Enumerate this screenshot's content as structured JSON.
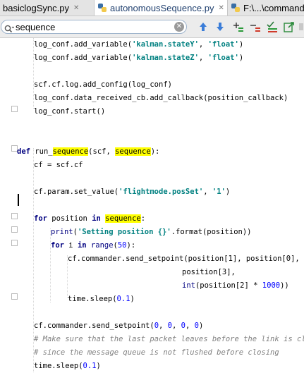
{
  "tabs": [
    {
      "label": "basiclogSync.py",
      "active": false
    },
    {
      "label": "autonomousSequence.py",
      "active": true
    },
    {
      "label": "F:\\...\\command",
      "active": false
    }
  ],
  "search": {
    "value": "sequence",
    "clear_icon": "✕"
  },
  "toolbar_icons": [
    "arrow-up-icon",
    "arrow-down-icon",
    "add-selection-icon",
    "remove-selection-icon",
    "select-all-icon",
    "export-icon",
    "more-icon"
  ],
  "code": [
    {
      "indent": 1,
      "segs": [
        [
          "p",
          "log_conf.add_variable("
        ],
        [
          "s",
          "'kalman.stateY'"
        ],
        [
          "p",
          ", "
        ],
        [
          "s",
          "'float'"
        ],
        [
          "p",
          ")"
        ]
      ]
    },
    {
      "indent": 1,
      "segs": [
        [
          "p",
          "log_conf.add_variable("
        ],
        [
          "s",
          "'kalman.stateZ'"
        ],
        [
          "p",
          ", "
        ],
        [
          "s",
          "'float'"
        ],
        [
          "p",
          ")"
        ]
      ]
    },
    {
      "indent": 0,
      "segs": []
    },
    {
      "indent": 1,
      "segs": [
        [
          "p",
          "scf.cf.log.add_config(log_conf)"
        ]
      ]
    },
    {
      "indent": 1,
      "segs": [
        [
          "p",
          "log_conf.data_received_cb.add_callback(position_callback)"
        ]
      ]
    },
    {
      "indent": 1,
      "segs": [
        [
          "p",
          "log_conf.start()"
        ]
      ]
    },
    {
      "indent": 0,
      "segs": []
    },
    {
      "indent": 0,
      "segs": []
    },
    {
      "indent": 0,
      "segs": [
        [
          "k",
          "def "
        ],
        [
          "p",
          "run_"
        ],
        [
          "h",
          "sequence"
        ],
        [
          "p",
          "(scf, "
        ],
        [
          "h",
          "sequence"
        ],
        [
          "p",
          "):"
        ]
      ]
    },
    {
      "indent": 1,
      "segs": [
        [
          "p",
          "cf = scf.cf"
        ]
      ]
    },
    {
      "indent": 0,
      "segs": []
    },
    {
      "indent": 1,
      "segs": [
        [
          "p",
          "cf.param.set_value("
        ],
        [
          "s",
          "'flightmode.posSet'"
        ],
        [
          "p",
          ", "
        ],
        [
          "s",
          "'1'"
        ],
        [
          "p",
          ")"
        ]
      ]
    },
    {
      "indent": 0,
      "segs": []
    },
    {
      "indent": 1,
      "segs": [
        [
          "k",
          "for "
        ],
        [
          "p",
          "position "
        ],
        [
          "k",
          "in "
        ],
        [
          "h",
          "sequence"
        ],
        [
          "p",
          ":"
        ]
      ]
    },
    {
      "indent": 2,
      "segs": [
        [
          "f",
          "print"
        ],
        [
          "p",
          "("
        ],
        [
          "s",
          "'Setting position {}'"
        ],
        [
          "p",
          ".format(position))"
        ]
      ]
    },
    {
      "indent": 2,
      "segs": [
        [
          "k",
          "for "
        ],
        [
          "p",
          "i "
        ],
        [
          "k",
          "in "
        ],
        [
          "f",
          "range"
        ],
        [
          "p",
          "("
        ],
        [
          "n",
          "50"
        ],
        [
          "p",
          "):"
        ]
      ]
    },
    {
      "indent": 3,
      "segs": [
        [
          "p",
          "cf.commander.send_setpoint(position[1], position[0],"
        ]
      ]
    },
    {
      "indent": 9,
      "segs": [
        [
          "p",
          "position[3],"
        ]
      ]
    },
    {
      "indent": 9,
      "segs": [
        [
          "f",
          "int"
        ],
        [
          "p",
          "(position[2] * "
        ],
        [
          "n",
          "1000"
        ],
        [
          "p",
          "))"
        ]
      ]
    },
    {
      "indent": 3,
      "segs": [
        [
          "p",
          "time.sleep("
        ],
        [
          "n",
          "0.1"
        ],
        [
          "p",
          ")"
        ]
      ]
    },
    {
      "indent": 0,
      "segs": []
    },
    {
      "indent": 1,
      "segs": [
        [
          "p",
          "cf.commander.send_setpoint("
        ],
        [
          "n",
          "0"
        ],
        [
          "p",
          ", "
        ],
        [
          "n",
          "0"
        ],
        [
          "p",
          ", "
        ],
        [
          "n",
          "0"
        ],
        [
          "p",
          ", "
        ],
        [
          "n",
          "0"
        ],
        [
          "p",
          ")"
        ]
      ]
    },
    {
      "indent": 1,
      "segs": [
        [
          "c",
          "# Make sure that the last packet leaves before the link is close"
        ]
      ]
    },
    {
      "indent": 1,
      "segs": [
        [
          "c",
          "# since the message queue is not flushed before closing"
        ]
      ]
    },
    {
      "indent": 1,
      "segs": [
        [
          "p",
          "time.sleep("
        ],
        [
          "n",
          "0.1"
        ],
        [
          "p",
          ")"
        ]
      ]
    }
  ]
}
